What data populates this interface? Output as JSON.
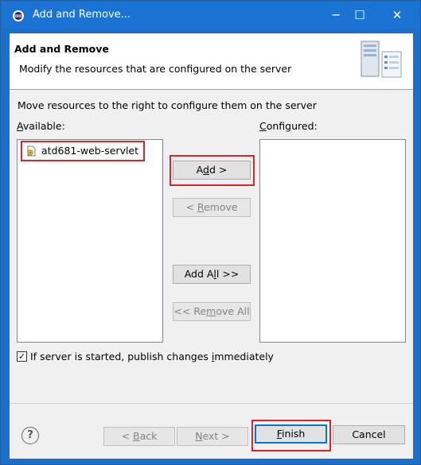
{
  "window": {
    "title": "Add and Remove...",
    "minimize_glyph": "─",
    "maximize_glyph": "☐",
    "close_glyph": "✕"
  },
  "banner": {
    "title": "Add and Remove",
    "description": "Modify the resources that are configured on the server",
    "icon": "server-icon"
  },
  "instruction": "Move resources to the right to configure them on the server",
  "available": {
    "label_prefix": "",
    "label_mnemonic": "A",
    "label_rest": "vailable:",
    "items": [
      {
        "label": "atd681-web-servlet",
        "icon": "web-project-icon"
      }
    ]
  },
  "configured": {
    "label_prefix": "",
    "label_mnemonic": "C",
    "label_rest": "onfigured:",
    "items": []
  },
  "buttons": {
    "add": {
      "pre": "A",
      "mn": "d",
      "post": "d >"
    },
    "remove": {
      "pre": "< ",
      "mn": "R",
      "post": "emove"
    },
    "add_all": {
      "pre": "Add A",
      "mn": "l",
      "post": "l >>"
    },
    "remove_all": {
      "pre": "<< Re",
      "mn": "m",
      "post": "ove All"
    },
    "back": {
      "pre": "< ",
      "mn": "B",
      "post": "ack"
    },
    "next": {
      "pre": "",
      "mn": "N",
      "post": "ext >"
    },
    "finish": {
      "pre": "",
      "mn": "F",
      "post": "inish"
    },
    "cancel": {
      "pre": "Cancel",
      "mn": "",
      "post": ""
    }
  },
  "publish_option": {
    "checked": true,
    "pre": "If server is started, publish changes ",
    "mn": "i",
    "post": "mmediately"
  },
  "help_glyph": "?"
}
